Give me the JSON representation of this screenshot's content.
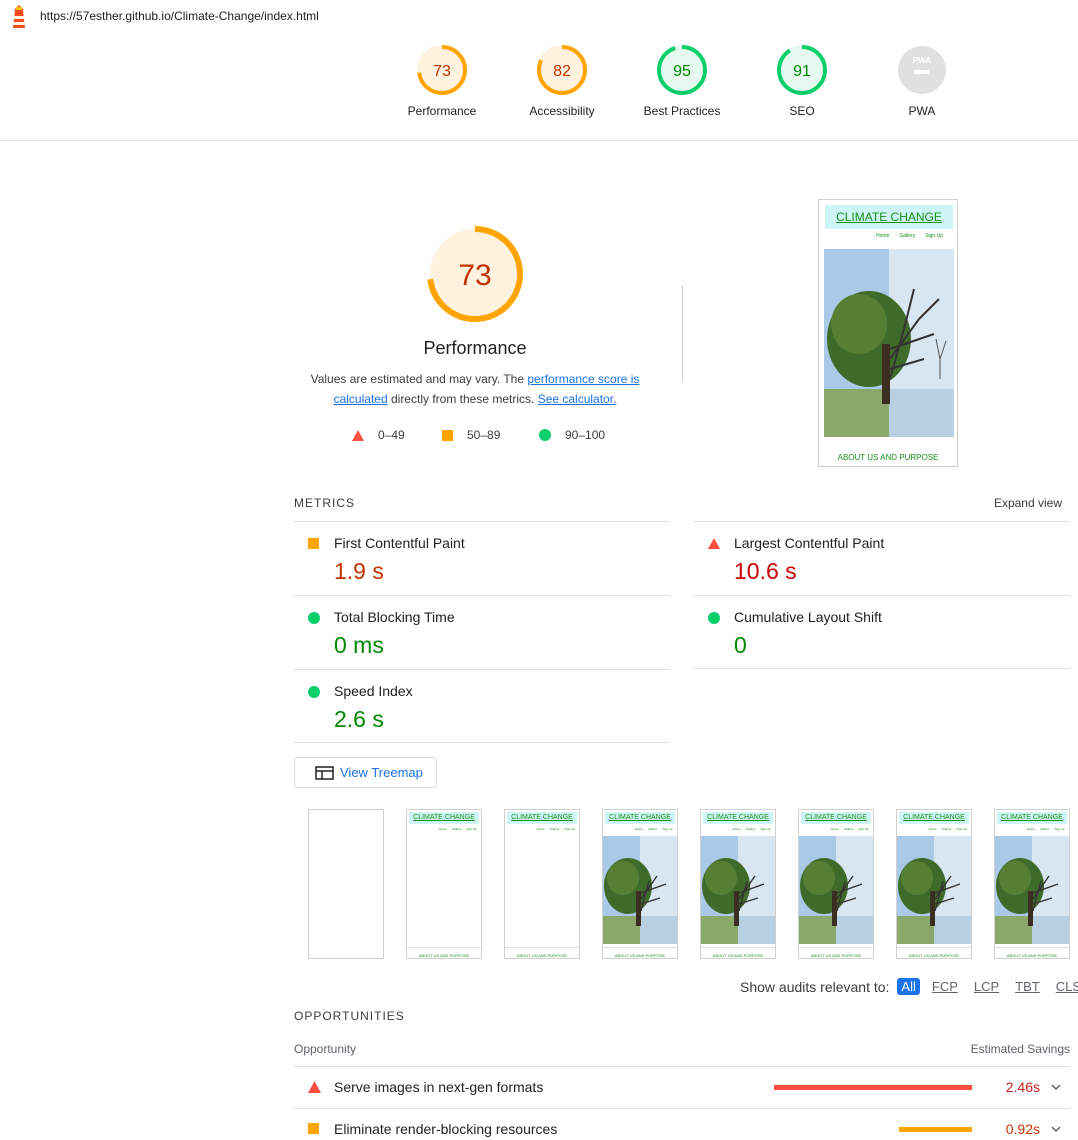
{
  "address_bar": {
    "url": "https://57esther.github.io/Climate-Change/index.html",
    "logo_icon": "lighthouse-icon"
  },
  "categories": [
    {
      "score": "73",
      "label": "Performance",
      "status": "average"
    },
    {
      "score": "82",
      "label": "Accessibility",
      "status": "average"
    },
    {
      "score": "95",
      "label": "Best Practices",
      "status": "pass"
    },
    {
      "score": "91",
      "label": "SEO",
      "status": "pass"
    },
    {
      "score": "PWA",
      "label": "PWA",
      "status": "na"
    }
  ],
  "performance": {
    "score": "73",
    "title": "Performance",
    "desc_prefix": "Values are estimated and may vary. The ",
    "link_score": "performance score is calculated",
    "desc_middle": " directly from these metrics. ",
    "link_calc": "See calculator.",
    "legend": [
      {
        "range": "0–49",
        "icon": "triangle-icon"
      },
      {
        "range": "50–89",
        "icon": "square-icon"
      },
      {
        "range": "90–100",
        "icon": "circle-icon"
      }
    ]
  },
  "preview": {
    "header": "CLIMATE CHANGE",
    "nav": [
      "Home",
      "Gallery",
      "Sign Up"
    ],
    "footer": "ABOUT US AND PURPOSE"
  },
  "metrics_section": {
    "label": "METRICS",
    "expand": "Expand view",
    "items": [
      {
        "title": "First Contentful Paint",
        "value": "1.9 s",
        "status": "average"
      },
      {
        "title": "Largest Contentful Paint",
        "value": "10.6 s",
        "status": "fail"
      },
      {
        "title": "Total Blocking Time",
        "value": "0 ms",
        "status": "pass"
      },
      {
        "title": "Cumulative Layout Shift",
        "value": "0",
        "status": "pass"
      },
      {
        "title": "Speed Index",
        "value": "2.6 s",
        "status": "pass"
      }
    ]
  },
  "treemap": {
    "label": "View Treemap",
    "icon": "treemap-icon"
  },
  "filmstrip": {
    "header": "CLIMATE CHANGE",
    "nav": [
      "Home",
      "Gallery",
      "Sign Up"
    ],
    "footer": "ABOUT US AND PURPOSE",
    "frames": [
      "blank",
      "text",
      "text",
      "image",
      "image",
      "image",
      "image",
      "image"
    ]
  },
  "filter": {
    "label": "Show audits relevant to:",
    "chips": [
      "All",
      "FCP",
      "LCP",
      "TBT",
      "CLS"
    ],
    "active": "All"
  },
  "opportunities": {
    "label": "OPPORTUNITIES",
    "col_left": "Opportunity",
    "col_right": "Estimated Savings",
    "items": [
      {
        "title": "Serve images in next-gen formats",
        "value": "2.46s",
        "status": "fail",
        "bar_fraction": 1.0
      },
      {
        "title": "Eliminate render-blocking resources",
        "value": "0.92s",
        "status": "average",
        "bar_fraction": 0.37
      }
    ]
  },
  "colors": {
    "pass": "#0cce6b",
    "average": "#ffa400",
    "fail": "#ff4e42",
    "pass_text": "#008800",
    "average_text": "#c33300",
    "fail_text": "#cc0000",
    "link": "#1a73e8"
  }
}
